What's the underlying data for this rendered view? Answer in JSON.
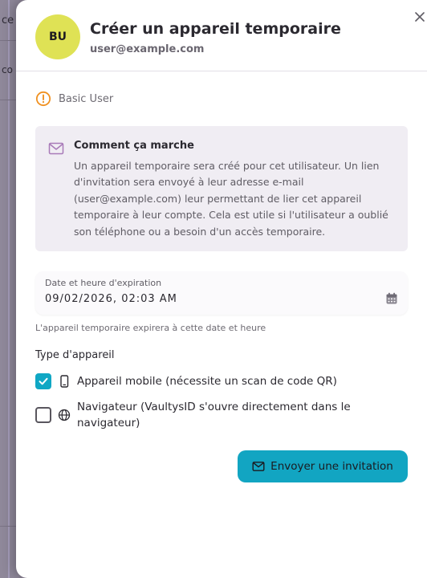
{
  "background": {
    "fragment_1": "ce",
    "fragment_2": "co"
  },
  "modal": {
    "avatar_initials": "BU",
    "title": "Créer un appareil temporaire",
    "subtitle": "user@example.com",
    "role": "Basic User",
    "info": {
      "title": "Comment ça marche",
      "body": "Un appareil temporaire sera créé pour cet utilisateur. Un lien d'invitation sera envoyé à leur adresse e-mail (user@example.com) leur permettant de lier cet appareil temporaire à leur compte. Cela est utile si l'utilisateur a oublié son téléphone ou a besoin d'un accès temporaire."
    },
    "expiration": {
      "label": "Date et heure d'expiration",
      "value": "09/02/2026, 02:03 AM",
      "help": "L'appareil temporaire expirera à cette date et heure"
    },
    "device_type": {
      "title": "Type d'appareil",
      "options": [
        {
          "label": "Appareil mobile (nécessite un scan de code QR)",
          "checked": true,
          "icon": "smartphone-icon"
        },
        {
          "label": "Navigateur (VaultysID s'ouvre directement dans le navigateur)",
          "checked": false,
          "icon": "globe-icon"
        }
      ]
    },
    "send_button_label": "Envoyer une invitation"
  },
  "colors": {
    "accent": "#10a7c4",
    "avatar_bg": "#dfe255",
    "warning": "#f0901f",
    "info_bg": "#f0edf3"
  }
}
